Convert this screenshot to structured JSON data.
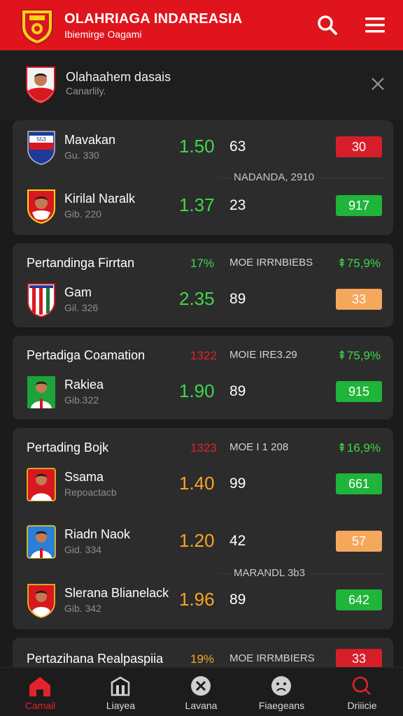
{
  "header": {
    "title": "OLAHRIAGA INDAREASIA",
    "subtitle": "Ibiemirge Oagami"
  },
  "notice": {
    "title": "Olahaahem dasais",
    "subtitle": "Canarlily."
  },
  "cards": [
    {
      "rows": [
        {
          "name": "Mavakan",
          "sub": "Gu. 330",
          "odd": "1.50",
          "num": "63",
          "btn": "30"
        },
        {
          "name": "Kirilal Naralk",
          "sub": "Gib. 220",
          "odd": "1.37",
          "num": "23",
          "btn": "917"
        }
      ],
      "divider": "NADANDA, 2910"
    },
    {
      "title": "Pertandinga Firrtan",
      "stat1": "17%",
      "stat2": "MOE IRRNBIEBS",
      "stat3": "⇞75,9%",
      "rows": [
        {
          "name": "Gam",
          "sub": "Gil. 326",
          "odd": "2.35",
          "num": "89",
          "btn": "33"
        }
      ]
    },
    {
      "title": "Pertadiga Coamation",
      "stat1": "1322",
      "stat2": "MOIE IRE3.29",
      "stat3": "⇞75,9%",
      "rows": [
        {
          "name": "Rakiea",
          "sub": "Gib.322",
          "odd": "1.90",
          "num": "89",
          "btn": "915"
        }
      ]
    },
    {
      "title": "Pertading Bojk",
      "stat1": "1323",
      "stat2": "MOE I 1 208",
      "stat3": "⇞16,9%",
      "rows": [
        {
          "name": "Ssama",
          "sub": "Repoactacb",
          "odd": "1.40",
          "num": "99",
          "btn": "661"
        },
        {
          "name": "Riadn Naok",
          "sub": "Gid. 334",
          "odd": "1.20",
          "num": "42",
          "btn": "57"
        },
        {
          "name": "Slerana Blianelack",
          "sub": "Gib. 342",
          "odd": "1.96",
          "num": "89",
          "btn": "642"
        }
      ],
      "divider": "MARANDL 3b3"
    },
    {
      "title": "Pertazihana Realpaspiia",
      "stat1": "19%",
      "stat2": "MOE IRRMBIERS",
      "btn": "33"
    }
  ],
  "nav": [
    {
      "label": "Camail",
      "icon": "home-icon",
      "active": true
    },
    {
      "label": "Liayea",
      "icon": "building-icon"
    },
    {
      "label": "Lavana",
      "icon": "close-circle-icon"
    },
    {
      "label": "Fiaegeans",
      "icon": "face-icon"
    },
    {
      "label": "Driiicie",
      "icon": "search-icon"
    }
  ],
  "colors": {
    "brand_red": "#e0141c",
    "odd_green": "#3fd84a",
    "odd_orange": "#f5a623",
    "btn_green": "#1fb53a",
    "btn_red": "#d61e2a",
    "btn_orange": "#f5a85c"
  }
}
